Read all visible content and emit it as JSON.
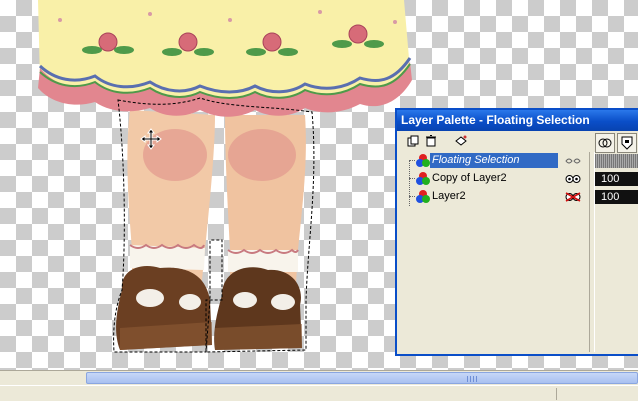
{
  "palette": {
    "title": "Layer Palette - Floating Selection",
    "toolbar": [
      "new-layer-icon",
      "delete-layer-icon",
      "layer-properties-icon"
    ],
    "right_toolbar": [
      "opacity-icon",
      "mask-icon"
    ],
    "layers": [
      {
        "name": "Floating Selection",
        "selected": true,
        "visibility": "hidden",
        "opacity": ""
      },
      {
        "name": "Copy of Layer2",
        "selected": false,
        "visibility": "visible",
        "opacity": "100"
      },
      {
        "name": "Layer2",
        "selected": false,
        "visibility": "off",
        "opacity": "100"
      }
    ]
  },
  "colors": {
    "title_bar": "#0a4ec8",
    "selection": "#316ac5",
    "checker": "#cccccc",
    "skirt": "#fff4b0",
    "trim": "#e2868f",
    "shoe": "#6b3f22"
  }
}
